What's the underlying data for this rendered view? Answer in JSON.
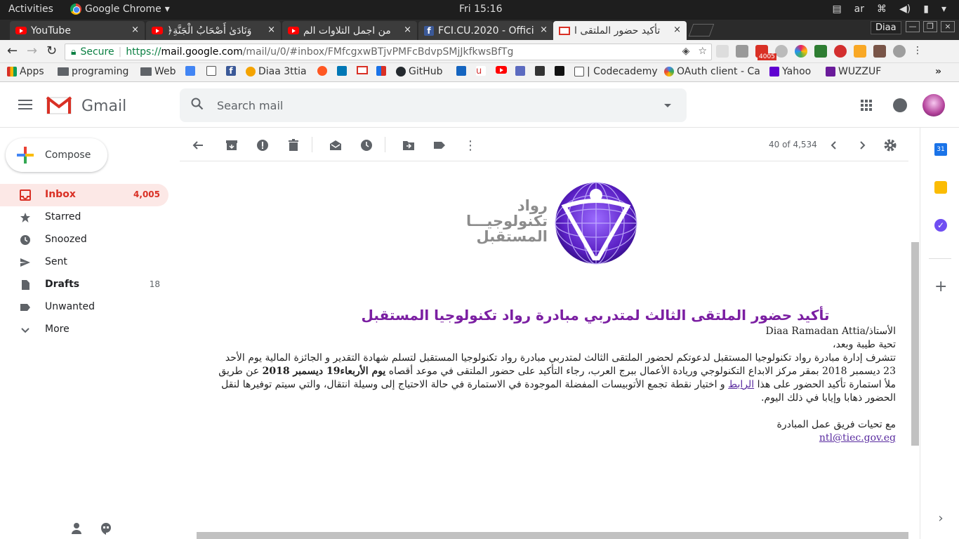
{
  "system": {
    "activities": "Activities",
    "app": "Google Chrome",
    "clock": "Fri 15:16",
    "lang": "ar"
  },
  "tabs": [
    {
      "title": "YouTube"
    },
    {
      "title": "﴿وَنَادَىٰ أَصْحَابُ الْجَنَّةِ"
    },
    {
      "title": "من اجمل التلاوات الم"
    },
    {
      "title": "FCI.CU.2020 - Offici"
    },
    {
      "title": "تأكيد حضور الملتقى ا"
    }
  ],
  "profile": "Diaa",
  "address": {
    "secure": "Secure",
    "scheme": "https://",
    "host": "mail.google.com",
    "path": "/mail/u/0/#inbox/FMfcgxwBTjvPMFcBdvpSMjJkfkwsBfTg"
  },
  "ext_badge": "4005",
  "bookmarks": [
    "Apps",
    "programing",
    "Web",
    "Diaa 3ttia",
    "GitHub",
    "| Codecademy",
    "OAuth client - Ca",
    "Yahoo",
    "WUZZUF"
  ],
  "gmail": {
    "wordmark": "Gmail",
    "search_placeholder": "Search mail",
    "compose": "Compose"
  },
  "nav": [
    {
      "label": "Inbox",
      "count": "4,005"
    },
    {
      "label": "Starred",
      "count": ""
    },
    {
      "label": "Snoozed",
      "count": ""
    },
    {
      "label": "Sent",
      "count": ""
    },
    {
      "label": "Drafts",
      "count": "18"
    },
    {
      "label": "Unwanted",
      "count": ""
    },
    {
      "label": "More",
      "count": ""
    }
  ],
  "pager": "40 of 4,534",
  "logo_lines": [
    "رواد",
    "تكنولوجيـــا",
    "المستقبل"
  ],
  "email": {
    "title": "تأكيد حضور الملتقى الثالث لمتدربي مبادرة رواد تكنولوجيا المستقبل",
    "greeting_prefix": "الأستاذ/",
    "greeting_name": "Diaa Ramadan Attia",
    "salutation": "تحية طيبة وبعد،",
    "p1": "تتشرف إدارة مبادرة رواد تكنولوجيا المستقبل لدعوتكم لحضور الملتقى الثالث لمتدربي مبادرة رواد تكنولوجيا المستقبل لتسلم شهادة التقدير و الجائزة المالية يوم الأحد 23 ديسمبر 2018 بمقر مركز الابداع التكنولوجي وريادة الأعمال ببرج العرب، رجاء التأكيد على حضور الملتقى في موعد أقصاه",
    "deadline": "يوم الأربعاء19 ديسمبر 2018",
    "p2": "عن طريق ملأ استمارة تأكيد الحضور على هذا",
    "link": "الرابط",
    "p3": "و  اختيار نقطة تجمع الأتوبيسات المفضلة الموجودة في الاستمارة في حالة الاحتياج إلى وسيلة انتقال، والتي سيتم توفيرها لنقل الحضور ذهابا وإيابا في ذلك اليوم.",
    "signoff": "مع تحيات فريق عمل المبادرة",
    "contact": "ntl@tiec.gov.eg"
  },
  "colors": {
    "gmail_red": "#d93025",
    "title_purple": "#7b1fa2",
    "secure_green": "#0b8043"
  }
}
